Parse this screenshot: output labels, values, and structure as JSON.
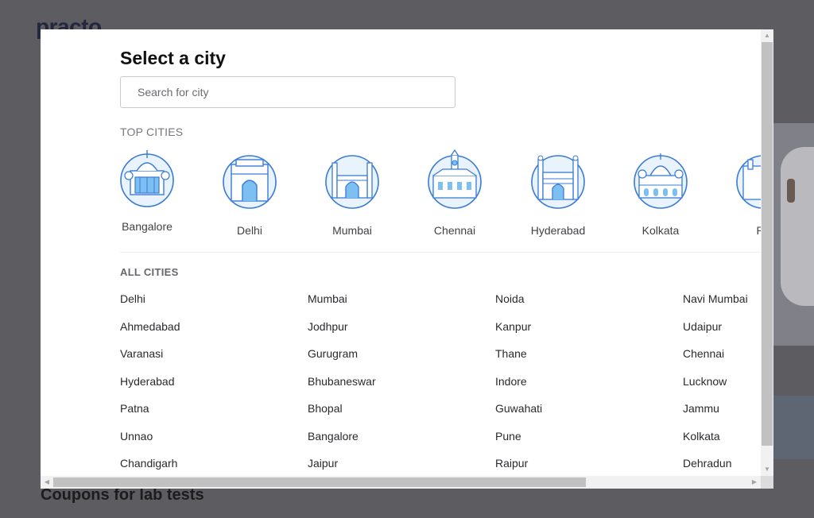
{
  "background": {
    "logo_text": "practo",
    "coupon_heading": "Coupons for lab tests"
  },
  "modal": {
    "title": "Select a city",
    "search_placeholder": "Search for city",
    "top_cities_heading": "TOP CITIES",
    "top_cities": [
      {
        "label": "Bangalore",
        "icon": "bangalore-palace-icon"
      },
      {
        "label": "Delhi",
        "icon": "india-gate-icon"
      },
      {
        "label": "Mumbai",
        "icon": "gateway-of-india-icon"
      },
      {
        "label": "Chennai",
        "icon": "chennai-central-icon"
      },
      {
        "label": "Hyderabad",
        "icon": "charminar-icon"
      },
      {
        "label": "Kolkata",
        "icon": "victoria-memorial-icon"
      },
      {
        "label": "Pu",
        "icon": "pune-landmark-icon"
      }
    ],
    "all_cities_heading": "ALL CITIES",
    "all_cities": [
      [
        "Delhi",
        "Mumbai",
        "Noida",
        "Navi Mumbai"
      ],
      [
        "Ahmedabad",
        "Jodhpur",
        "Kanpur",
        "Udaipur"
      ],
      [
        "Varanasi",
        "Gurugram",
        "Thane",
        "Chennai"
      ],
      [
        "Hyderabad",
        "Bhubaneswar",
        "Indore",
        "Lucknow"
      ],
      [
        "Patna",
        "Bhopal",
        "Guwahati",
        "Jammu"
      ],
      [
        "Unnao",
        "Bangalore",
        "Pune",
        "Kolkata"
      ],
      [
        "Chandigarh",
        "Jaipur",
        "Raipur",
        "Dehradun"
      ]
    ]
  },
  "colors": {
    "overlay": "#5c5c61",
    "icon_stroke": "#3a7bd5",
    "icon_fill": "#e8f3fd",
    "icon_accent": "#7cc0f2"
  }
}
